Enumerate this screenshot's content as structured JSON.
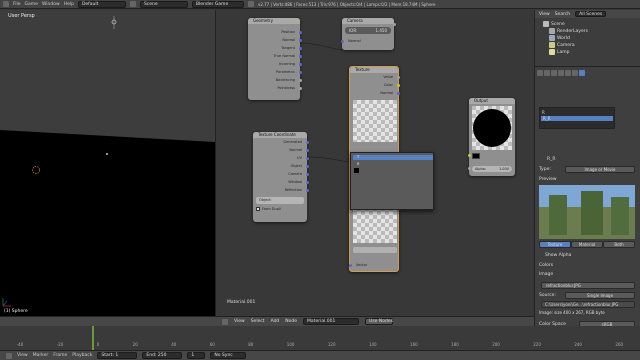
{
  "topbar": {
    "menus": [
      "File",
      "Game",
      "Window",
      "Help"
    ],
    "layout": "Default",
    "scene": "Scene",
    "engine": "Blender Game",
    "stats": "v2.77 | Verts:486 | Faces:513 | Tris:976 | Objects:0/4 | Lamps:0/2 | Mem:18.74M | Sphere"
  },
  "viewport": {
    "label": "User Persp",
    "object_label": "(1) Sphere"
  },
  "nodes": {
    "geometry": {
      "title": "Geometry",
      "outputs": [
        "Position",
        "Normal",
        "Tangent",
        "True Normal",
        "Incoming",
        "Parametric",
        "Backfacing",
        "Pointiness"
      ]
    },
    "camera_data": {
      "title": "Camera",
      "field_label": "IOR:",
      "field_value": "1.450",
      "output": "Normal"
    },
    "texture": {
      "title": "Texture",
      "outputs": [
        "Value",
        "Color",
        "Normal"
      ],
      "footer": "Vector"
    },
    "texcoord": {
      "title": "Texture Coordinate",
      "outputs": [
        "Generated",
        "Normal",
        "UV",
        "Object",
        "Camera",
        "Window",
        "Reflection"
      ],
      "object_label": "Object:",
      "from_dupli": "From Dupli"
    },
    "output": {
      "title": "Output",
      "alpha_label": "Alpha:",
      "alpha_value": "1.000"
    },
    "dropdown": {
      "items": [
        "T",
        "R",
        "M"
      ]
    }
  },
  "material_label": "Material.001",
  "node_header": {
    "menus": [
      "View",
      "Select",
      "Add",
      "Node"
    ],
    "material": "Material.001",
    "use_nodes": "Use Nodes"
  },
  "outliner": {
    "tabs": [
      "View",
      "Search",
      "All Scenes"
    ],
    "items": [
      "Scene",
      "RenderLayers",
      "World",
      "Camera",
      "Lamp"
    ]
  },
  "properties": {
    "tex_slots": [
      "R",
      "R_R"
    ],
    "tex_name": "R_R",
    "type_label": "Type:",
    "type_value": "Image or Movie",
    "preview_label": "Preview",
    "preview_tabs": [
      "Texture",
      "Material",
      "Both"
    ],
    "show_alpha": "Show Alpha",
    "colors_label": "Colors",
    "image_label": "Image",
    "image_name": "refractionblur.JPG",
    "source_label": "Source:",
    "source_value": "Single Image",
    "path": "C:\\Users\\yoni\\Ge...\\refractionblur.JPG",
    "image_info": "Image: size 400 x 267, RGB byte",
    "color_space_label": "Color Space",
    "color_space_value": "sRGB",
    "view_as_render": "View as Render",
    "fields": "Fields",
    "upper_first": "Upper First",
    "lower_first": "Lower First"
  },
  "bottom": {
    "menus": [
      "View",
      "Marker",
      "Frame",
      "Playback"
    ],
    "start_label": "Start:",
    "start_value": "1",
    "end_label": "End:",
    "end_value": "250",
    "current": "1",
    "sync": "No Sync"
  },
  "timeline_ticks": [
    "-40",
    "-20",
    "0",
    "20",
    "40",
    "60",
    "80",
    "100",
    "120",
    "140",
    "160",
    "180",
    "200",
    "220",
    "240",
    "260"
  ],
  "colors": {
    "socket_yellow": "#c7c729",
    "socket_blue": "#6363c7",
    "socket_gray": "#a1a1a1",
    "selected_blue": "#5680c2",
    "frame_green": "#6a9a3c"
  }
}
